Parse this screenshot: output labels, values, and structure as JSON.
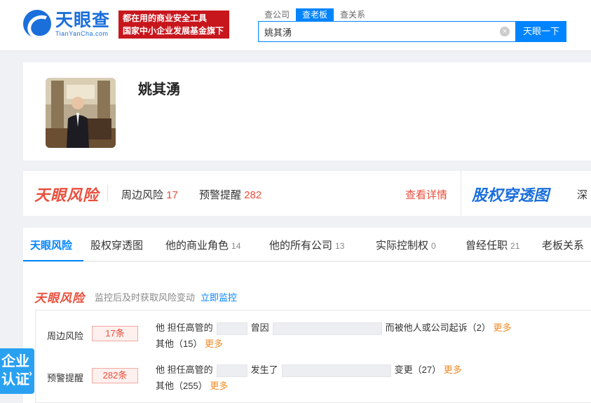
{
  "header": {
    "logo_main": "天眼查",
    "logo_sub": "TianYanCha.com",
    "slogan_line1": "都在用的商业安全工具",
    "slogan_line2": "国家中小企业发展基金旗下",
    "search_tabs": [
      "查公司",
      "查老板",
      "查关系"
    ],
    "search_value": "姚其湧",
    "search_button": "天眼一下"
  },
  "profile": {
    "name": "姚其湧"
  },
  "risk_bar": {
    "brand": "天眼风险",
    "surround_label": "周边风险",
    "surround_count": "17",
    "warning_label": "预警提醒",
    "warning_count": "282",
    "detail_link": "查看详情",
    "equity_brand": "股权穿透图",
    "deep_label": "深"
  },
  "tabs": [
    {
      "label": "天眼风险",
      "count": ""
    },
    {
      "label": "股权穿透图",
      "count": ""
    },
    {
      "label": "他的商业角色",
      "count": "14"
    },
    {
      "label": "他的所有公司",
      "count": "13"
    },
    {
      "label": "实际控制权",
      "count": "0"
    },
    {
      "label": "曾经任职",
      "count": "21"
    },
    {
      "label": "老板关系",
      "count": ""
    }
  ],
  "monitor": {
    "brand": "天眼风险",
    "tip": "监控后及时获取风险变动",
    "link": "立即监控"
  },
  "risk_rows": [
    {
      "label": "周边风险",
      "tag": "17条",
      "line1_a": "他 担任高管的",
      "line1_b": "曾因",
      "line1_c": "而被他人或公司起诉（2）",
      "line1_more": "更多",
      "line2_a": "其他（15）",
      "line2_more": "更多"
    },
    {
      "label": "预警提醒",
      "tag": "282条",
      "line1_a": "他 担任高管的",
      "line1_b": "发生了",
      "line1_c": "变更（27）",
      "line1_more": "更多",
      "line2_a": "其他（255）",
      "line2_more": "更多"
    }
  ],
  "float_tab": {
    "line1": "企业",
    "line2": "认证"
  },
  "colors": {
    "brand_blue": "#0084ff",
    "risk_red": "#e94e3c",
    "more_orange": "#f08a24",
    "slogan_red": "#c8161d"
  }
}
